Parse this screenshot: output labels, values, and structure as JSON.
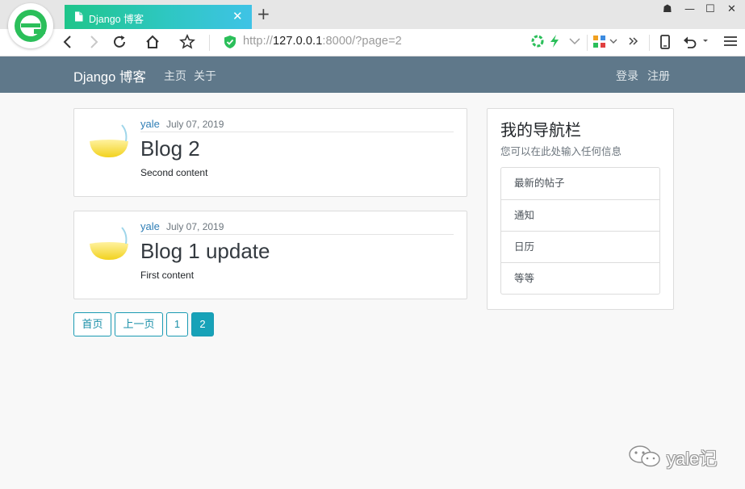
{
  "browser": {
    "tab": {
      "title": "Django 博客",
      "close_glyph": "✕"
    },
    "new_tab_glyph": "+",
    "url": {
      "scheme": "http://",
      "host": "127.0.0.1",
      "rest": ":8000/?page=2"
    },
    "window_buttons": [
      "☗",
      "—",
      "☐",
      "✕"
    ],
    "icons": [
      "back-icon",
      "forward-icon",
      "reload-icon",
      "home-icon",
      "bookmark-star-icon",
      "shield-icon",
      "extension-icon",
      "lightning-icon",
      "dropdown-icon",
      "apps-icon",
      "more-icon",
      "phone-icon",
      "undo-icon",
      "menu-icon"
    ]
  },
  "navbar": {
    "brand": "Django 博客",
    "links": [
      "主页",
      "关于"
    ],
    "auth": [
      "登录",
      "注册"
    ],
    "bg": "#5f788a"
  },
  "posts": [
    {
      "author": "yale",
      "date": "July 07, 2019",
      "title": "Blog 2",
      "content": "Second content"
    },
    {
      "author": "yale",
      "date": "July 07, 2019",
      "title": "Blog 1 update",
      "content": "First content"
    }
  ],
  "pagination": {
    "items": [
      "首页",
      "上一页",
      "1",
      "2"
    ],
    "current": "2",
    "accent": "#17a2b8"
  },
  "sidebar": {
    "title": "我的导航栏",
    "subtitle": "您可以在此处输入任何信息",
    "items": [
      "最新的帖子",
      "通知",
      "日历",
      "等等"
    ]
  },
  "watermark": {
    "text": "yale记"
  }
}
